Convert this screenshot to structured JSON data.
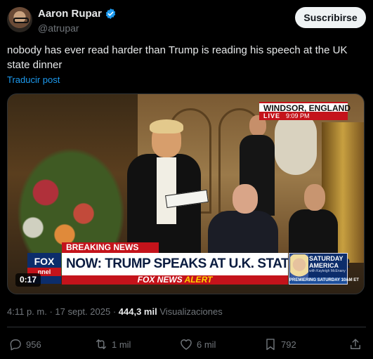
{
  "author": {
    "display_name": "Aaron Rupar",
    "handle": "@atrupar",
    "verified": true,
    "verified_color": "#1d9bf0"
  },
  "subscribe_label": "Suscribirse",
  "post": {
    "text": "nobody has ever read harder than Trump is reading his speech at the UK state dinner",
    "translate_label": "Traducir post"
  },
  "video": {
    "timecode": "0:17",
    "broadcast": {
      "location": "WINDSOR, ENGLAND",
      "live": "LIVE",
      "time": "9:09 PM",
      "breaking_label": "BREAKING NEWS",
      "headline": "NOW: TRUMP SPEAKS AT U.K. STATE DINNER",
      "alert_brand": "FOX NEWS",
      "alert_word": "ALERT",
      "logo_top": "FOX",
      "logo_bottom": "nnel",
      "promo_line1": "SATURDAY",
      "promo_line2": "AMERICA",
      "promo_line3": "with Kayleigh McEnany",
      "promo_footer": "PREMIERING SATURDAY 10AM ET"
    }
  },
  "meta": {
    "timestamp": "4:11 p. m. · 17 sept. 2025",
    "separator": "·",
    "views_count": "444,3 mil",
    "views_label": "Visualizaciones"
  },
  "actions": {
    "replies": "956",
    "reposts": "1 mil",
    "likes": "6 mil",
    "bookmarks": "792"
  },
  "colors": {
    "background": "#000000",
    "text": "#e7e9ea",
    "muted": "#71767b",
    "link": "#1d9bf0",
    "fox_red": "#c4131b",
    "fox_blue": "#0c2d6b"
  }
}
